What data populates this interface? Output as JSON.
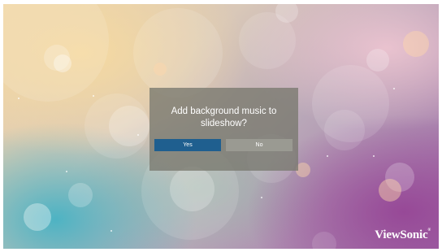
{
  "dialog": {
    "message": "Add background music to slideshow?",
    "yes_label": "Yes",
    "no_label": "No",
    "selected": "Yes"
  },
  "brand": {
    "name": "ViewSonic",
    "mark": "®"
  },
  "colors": {
    "selected_button": "#1f5f8f",
    "unselected_button": "#9a9a92",
    "dialog_background": "#787870"
  }
}
